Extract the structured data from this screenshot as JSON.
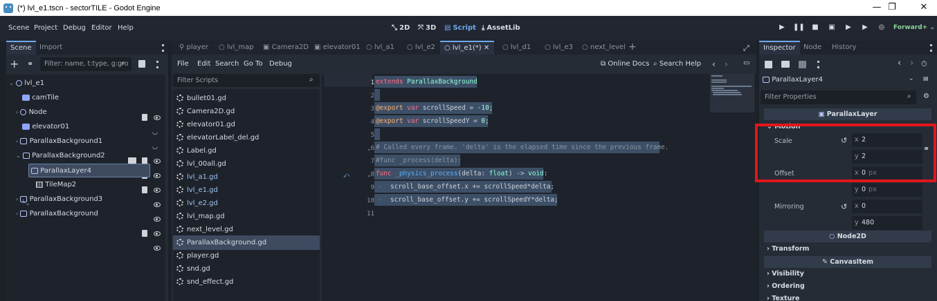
{
  "window": {
    "title": "(*) lvl_e1.tscn - sectorTILE - Godot Engine",
    "minimize": "—",
    "maximize": "❐",
    "close": "✕"
  },
  "menu": {
    "items": [
      "Scene",
      "Project",
      "Debug",
      "Editor",
      "Help"
    ]
  },
  "modes": {
    "m2d": "2D",
    "m3d": "3D",
    "script": "Script",
    "assetlib": "AssetLib"
  },
  "renderer": "Forward+",
  "scene_dock": {
    "tabs": [
      "Scene",
      "Import"
    ],
    "filter_placeholder": "Filter: name, t:type, g:gro",
    "nodes": [
      {
        "label": "lvl_e1"
      },
      {
        "label": "camTile"
      },
      {
        "label": "Node"
      },
      {
        "label": "elevator01"
      },
      {
        "label": "ParallaxBackground1"
      },
      {
        "label": "ParallaxBackground2"
      },
      {
        "label": "ParallaxLayer4"
      },
      {
        "label": "TileMap2"
      },
      {
        "label": "ParallaxBackground3"
      },
      {
        "label": "ParallaxBackground"
      }
    ]
  },
  "editor_tabs": [
    "player",
    "lvl_map",
    "Camera2D",
    "elevator01",
    "lvl_a1",
    "lvl_e2",
    "lvl_e1(*)",
    "lvl_d1",
    "lvl_e3",
    "next_level"
  ],
  "script_menu": {
    "items": [
      "File",
      "Edit",
      "Search",
      "Go To",
      "Debug"
    ],
    "online_docs": "Online Docs",
    "search_help": "Search Help"
  },
  "scripts": {
    "filter_placeholder": "Filter Scripts",
    "files": [
      "bullet01.gd",
      "Camera2D.gd",
      "elevator01.gd",
      "elevatorLabel_del.gd",
      "Label.gd",
      "lvl_00all.gd",
      "lvl_a1.gd",
      "lvl_e1.gd",
      "lvl_e2.gd",
      "lvl_map.gd",
      "next_level.gd",
      "ParallaxBackground.gd",
      "player.gd",
      "snd.gd",
      "snd_effect.gd"
    ]
  },
  "code": {
    "line_numbers": [
      "1",
      "2",
      "3",
      "4",
      "5",
      "6",
      "7",
      "8",
      "9",
      "10",
      "11"
    ],
    "l1_kw": "extends",
    "l1_ty": "ParallaxBackground",
    "l3_an": "@export",
    "l3_kw": "var",
    "l3_rest": " scrollSpeed = ",
    "l3_num": "-10",
    "l3_end": ";",
    "l4_an": "@export",
    "l4_kw": "var",
    "l4_rest": " scrollSpeedY = ",
    "l4_num": "0",
    "l4_end": ";",
    "l6": "# Called every frame. 'delta' is the elapsed time since the previous frame.",
    "l7": "#func _process(delta):",
    "l8_kw": "func",
    "l8_fn": "_physics_process",
    "l8_a": "(delta: ",
    "l8_ty": "float",
    "l8_b": ") -> ",
    "l8_ty2": "void",
    "l8_c": ":",
    "l9": "scroll_base_offset.x += scrollSpeed*delta;",
    "l10": "scroll_base_offset.y += scrollSpeedY*delta;"
  },
  "inspector": {
    "tabs": [
      "Inspector",
      "Node",
      "History"
    ],
    "object": "ParallaxLayer4",
    "filter_placeholder": "Filter Properties",
    "section_parallax": "ParallaxLayer",
    "group_motion": "Motion",
    "scale_label": "Scale",
    "scale_x": "2",
    "scale_y": "2",
    "offset_label": "Offset",
    "offset_x": "0",
    "offset_y": "0",
    "unit": "px",
    "mirroring_label": "Mirroring",
    "mirroring_x": "0",
    "mirroring_y": "480",
    "axis_x": "x",
    "axis_y": "y",
    "section_node2d": "Node2D",
    "group_transform": "Transform",
    "section_canvasitem": "CanvasItem",
    "group_visibility": "Visibility",
    "group_ordering": "Ordering",
    "group_texture": "Texture"
  },
  "colors": {
    "accent": "#6ea9ee",
    "highlight_box": "#e2161b",
    "renderer": "#8ed29a"
  }
}
